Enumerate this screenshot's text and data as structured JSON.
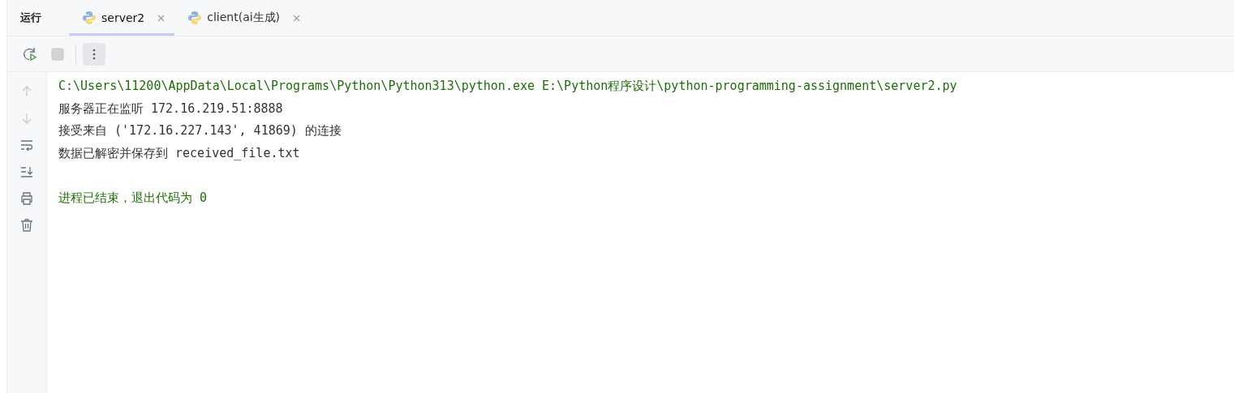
{
  "panel_title": "运行",
  "tabs": [
    {
      "label": "server2",
      "selected": true
    },
    {
      "label": "client(ai生成)",
      "selected": false
    }
  ],
  "toolbar": {
    "rerun": {
      "disabled": false
    },
    "stop": {
      "disabled": true
    }
  },
  "gutter": [
    {
      "kind": "up",
      "disabled": true
    },
    {
      "kind": "down",
      "disabled": true
    },
    {
      "kind": "wrap",
      "disabled": false
    },
    {
      "kind": "scroll-end",
      "disabled": false
    },
    {
      "kind": "print",
      "disabled": false
    },
    {
      "kind": "trash",
      "disabled": false
    }
  ],
  "console": [
    {
      "kind": "command",
      "text": "C:\\Users\\11200\\AppData\\Local\\Programs\\Python\\Python313\\python.exe E:\\Python程序设计\\python-programming-assignment\\server2.py"
    },
    {
      "kind": "output",
      "text": "服务器正在监听 172.16.219.51:8888"
    },
    {
      "kind": "output",
      "text": "接受来自 ('172.16.227.143', 41869) 的连接"
    },
    {
      "kind": "output",
      "text": "数据已解密并保存到 received_file.txt"
    },
    {
      "kind": "exit",
      "text": "进程已结束，退出代码为 0"
    }
  ]
}
